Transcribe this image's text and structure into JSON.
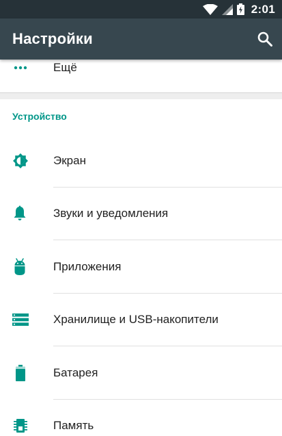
{
  "status_bar": {
    "time": "2:01"
  },
  "app_bar": {
    "title": "Настройки"
  },
  "more_item": {
    "label": "Ещё"
  },
  "section": {
    "header": "Устройство",
    "items": [
      {
        "label": "Экран",
        "icon": "brightness-icon"
      },
      {
        "label": "Звуки и уведомления",
        "icon": "bell-icon"
      },
      {
        "label": "Приложения",
        "icon": "android-icon"
      },
      {
        "label": "Хранилище и USB-накопители",
        "icon": "storage-icon"
      },
      {
        "label": "Батарея",
        "icon": "battery-icon"
      },
      {
        "label": "Память",
        "icon": "memory-icon"
      }
    ]
  },
  "colors": {
    "accent": "#009688",
    "app_bar": "#37474f",
    "status_bar": "#263238"
  }
}
